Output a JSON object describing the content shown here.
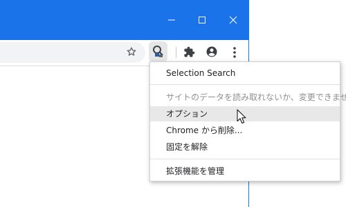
{
  "window": {
    "controls": [
      "minimize-icon",
      "maximize-icon",
      "close-icon"
    ],
    "accent": "#1a73e8"
  },
  "toolbar": {
    "icons": [
      "bookmark-star-icon",
      "selection-search-extension-icon",
      "extensions-puzzle-icon",
      "profile-icon",
      "more-menu-icon"
    ]
  },
  "context_menu": {
    "items": [
      {
        "label": "Selection Search",
        "state": "normal"
      },
      {
        "label": "サイトのデータを読み取れないか、変更できません",
        "state": "disabled"
      },
      {
        "label": "オプション",
        "state": "hovered"
      },
      {
        "label": "Chrome から削除...",
        "state": "normal"
      },
      {
        "label": "固定を解除",
        "state": "normal"
      },
      {
        "label": "拡張機能を管理",
        "state": "normal"
      }
    ]
  }
}
